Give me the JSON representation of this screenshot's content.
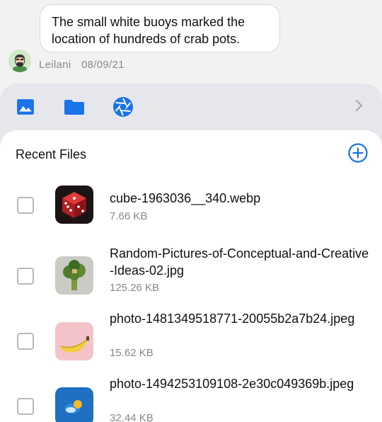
{
  "chat": {
    "message_text": "The small white buoys marked the location of hundreds of crab pots.",
    "sender": "Leilani",
    "date": "08/09/21"
  },
  "toolbar": {
    "icons": [
      "image-icon",
      "folder-icon",
      "camera-aperture-icon",
      "chevron-right-icon"
    ],
    "accent_color": "#1a73e8"
  },
  "panel": {
    "title": "Recent Files"
  },
  "files": [
    {
      "name": "cube-1963036__340.webp",
      "size": "7.66 KB",
      "thumb": "red-dice"
    },
    {
      "name": "Random-Pictures-of-Conceptual-and-Creative-Ideas-02.jpg",
      "size": "125.26 KB",
      "thumb": "broccoli-house"
    },
    {
      "name": "photo-1481349518771-20055b2a7b24.jpeg",
      "size": "15.62 KB",
      "thumb": "banana-pink"
    },
    {
      "name": "photo-1494253109108-2e30c049369b.jpeg",
      "size": "32.44 KB",
      "thumb": "fruit-blue"
    }
  ]
}
